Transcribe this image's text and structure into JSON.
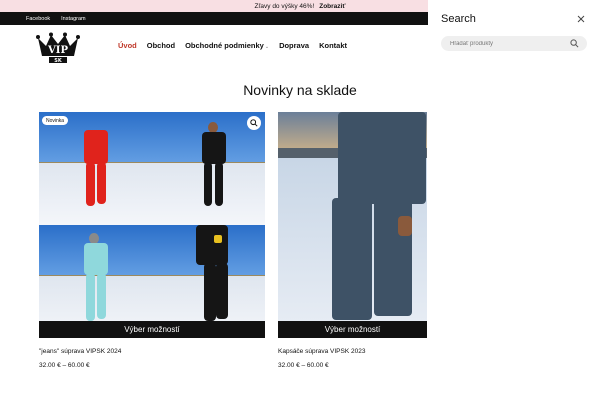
{
  "announcement": {
    "text": "Zľavy do výšky 46%!",
    "cta": "Zobraziť"
  },
  "topbar": {
    "links": [
      "Facebook",
      "Instagram"
    ]
  },
  "logo": {
    "text": "VIP",
    "subtext": "SK"
  },
  "nav": {
    "items": [
      "Úvod",
      "Obchod",
      "Obchodné podmienky",
      "Doprava",
      "Kontakt"
    ]
  },
  "section": {
    "title": "Novinky na sklade"
  },
  "products": [
    {
      "badge": "Novinka",
      "button": "Výber možností",
      "title": "\"jeans\" súprava VIPSK 2024",
      "price": "32.00 € – 60.00 €"
    },
    {
      "button": "Výber možností",
      "title": "Kapsáče súprava VIPSK 2023",
      "price": "32.00 € – 60.00 €"
    }
  ],
  "search": {
    "title": "Search",
    "placeholder": "Hľadať produkty"
  },
  "colors": {
    "accent": "#c0392b",
    "announce_bg": "#f8dfe3",
    "dark": "#111111"
  }
}
